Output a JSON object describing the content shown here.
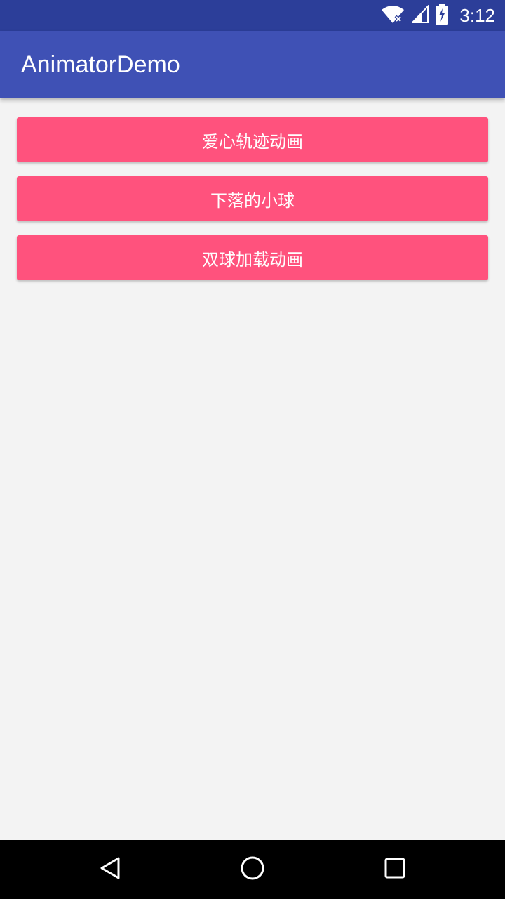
{
  "status_bar": {
    "time": "3:12",
    "icons": [
      "wifi-icon",
      "signal-icon",
      "battery-charging-icon"
    ],
    "background": "#2c3e99"
  },
  "app_bar": {
    "title": "AnimatorDemo",
    "background": "#3f51b5"
  },
  "main": {
    "buttons": [
      {
        "label": "爱心轨迹动画"
      },
      {
        "label": "下落的小球"
      },
      {
        "label": "双球加载动画"
      }
    ],
    "button_color": "#ff527d"
  },
  "nav_bar": {
    "icons": [
      "back-icon",
      "home-icon",
      "recents-icon"
    ]
  }
}
